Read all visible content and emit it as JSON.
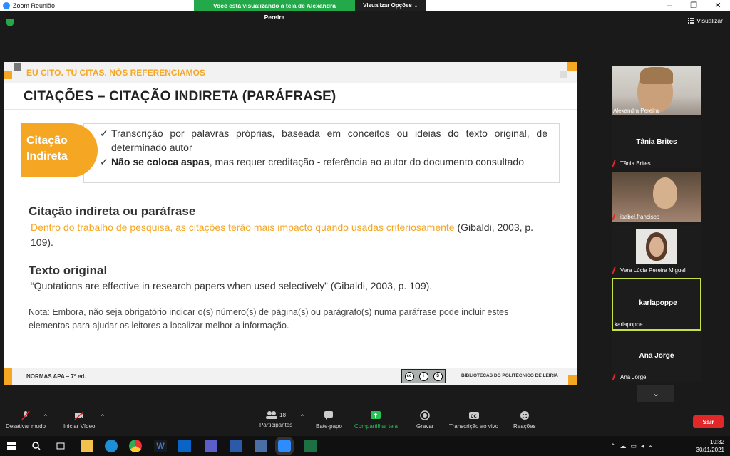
{
  "window": {
    "title": "Zoom Reunião",
    "controls": [
      "–",
      "❐",
      "✕"
    ]
  },
  "share_banner": {
    "message": "Você está visualizando a tela de Alexandra Pereira",
    "options": "Visualizar Opções ⌄"
  },
  "view_button": {
    "label": "Visualizar"
  },
  "slide": {
    "top_title": "EU CITO. TU CITAS. NÓS REFERENCIAMOS",
    "heading": "CITAÇÕES – CITAÇÃO INDIRETA (PARÁFRASE)",
    "badge_line1": "Citação",
    "badge_line2": "Indireta",
    "bullet1": "Transcrição por palavras próprias, baseada em conceitos ou ideias do texto original, de determinado autor",
    "bullet2_bold": "Não se coloca aspas",
    "bullet2_rest": ", mas requer creditação - referência ao autor do documento consultado",
    "section1_title": "Citação indireta ou paráfrase",
    "section1_orange": "Dentro do trabalho de pesquisa, as citações terão mais impacto quando usadas criteriosamente",
    "section1_ref": " (Gibaldi, 2003, p. 109).",
    "section2_title": "Texto original",
    "section2_text": "“Quotations are effective in research papers when used selectively” (Gibaldi, 2003, p. 109).",
    "note": "Nota: Embora, não seja obrigatório indicar o(s) número(s) de página(s) ou parágrafo(s) numa paráfrase pode incluir estes elementos para ajudar os leitores a localizar melhor a informação.",
    "footer_left": "NORMAS APA – 7ª ed.",
    "footer_right": "BIBLIOTECAS DO POLITÉCNICO DE LEIRIA",
    "cc_labels": [
      "cc",
      "i",
      "$"
    ]
  },
  "participants": [
    {
      "name": "Alexandra Pereira",
      "video": true,
      "muted": false,
      "active": false
    },
    {
      "name": "Tânia Brites",
      "video": false,
      "muted": true,
      "active": false
    },
    {
      "name": "isabel.francisco",
      "video": true,
      "muted": true,
      "active": false
    },
    {
      "name": "Vera Lúcia Pereira Miguel",
      "video": true,
      "muted": true,
      "active": false
    },
    {
      "name": "karlapoppe",
      "video": false,
      "muted": false,
      "active": true
    },
    {
      "name": "Ana Jorge",
      "video": false,
      "muted": true,
      "active": false
    }
  ],
  "toolbar": {
    "mute": "Desativar mudo",
    "video": "Iniciar Vídeo",
    "participants": "Participantes",
    "participants_count": "18",
    "chat": "Bate-papo",
    "share": "Compartilhar tela",
    "record": "Gravar",
    "transcription": "Transcrição ao vivo",
    "reactions": "Reações",
    "leave": "Sair"
  },
  "taskbar": {
    "time": "10:32",
    "date": "30/11/2021"
  },
  "colors": {
    "accent_orange": "#f5a623",
    "share_green": "#23a84a",
    "leave_red": "#e02828",
    "active_speaker": "#c7e04a"
  }
}
